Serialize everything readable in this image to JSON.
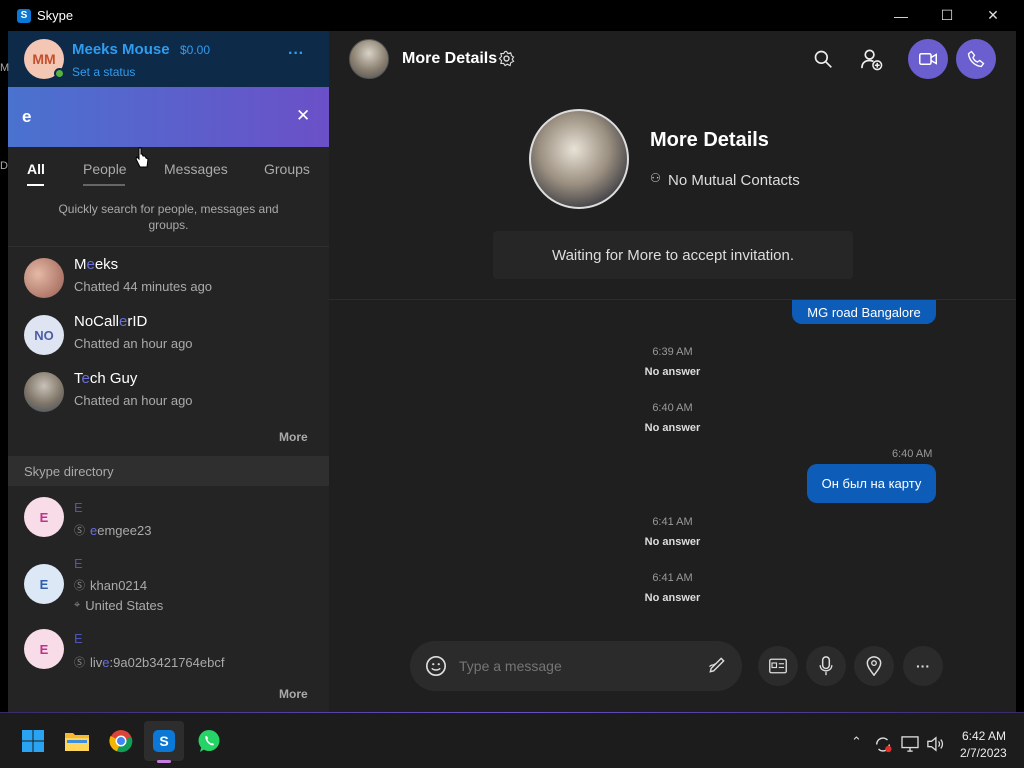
{
  "window": {
    "title": "Skype",
    "minimize": "—",
    "maximize": "☐",
    "close": "✕"
  },
  "profile": {
    "initials": "MM",
    "name": "Meeks Mouse",
    "balance": "$0.00",
    "status": "Set a status",
    "more": "···"
  },
  "search": {
    "value": "e",
    "clear": "✕"
  },
  "tabs": [
    {
      "label": "All"
    },
    {
      "label": "People"
    },
    {
      "label": "Messages"
    },
    {
      "label": "Groups"
    }
  ],
  "hint": "Quickly search for people, messages and groups.",
  "results": [
    {
      "pre": "M",
      "hl": "e",
      "post": "eks",
      "sub": "Chatted 44 minutes ago"
    },
    {
      "initials": "NO",
      "pre": "NoCall",
      "hl": "e",
      "post": "rID",
      "sub": "Chatted an hour ago"
    },
    {
      "pre": "T",
      "hl": "e",
      "post": "ch Guy",
      "sub": "Chatted an hour ago"
    }
  ],
  "results_more": "More",
  "directory": {
    "header": "Skype directory",
    "items": [
      {
        "initial": "E",
        "name": "E",
        "id_hl": "e",
        "id_rest": "emgee23"
      },
      {
        "initial": "E",
        "name": "E",
        "id_pre": "khan0214",
        "location": "United States"
      },
      {
        "initial": "E",
        "name": "E",
        "id_pre": "liv",
        "id_hl": "e",
        "id_rest": ":9a02b3421764ebcf"
      }
    ],
    "more": "More"
  },
  "chat": {
    "header_name": "More Details",
    "contact_name": "More Details",
    "mutual": "No Mutual Contacts",
    "invite": "Waiting for More to accept invitation.",
    "messages": [
      {
        "type": "bubble",
        "text": "MG road Bangalore"
      },
      {
        "type": "call",
        "time": "6:39 AM",
        "status": "No answer"
      },
      {
        "type": "call",
        "time": "6:40 AM",
        "status": "No answer"
      },
      {
        "type": "bubble",
        "time": "6:40 AM",
        "text": "Он был на карту"
      },
      {
        "type": "call",
        "time": "6:41 AM",
        "status": "No answer"
      },
      {
        "type": "call",
        "time": "6:41 AM",
        "status": "No answer"
      }
    ],
    "compose_placeholder": "Type a message"
  },
  "taskbar": {
    "time": "6:42 AM",
    "date": "2/7/2023"
  },
  "colors": {
    "accent": "#6b5fd0",
    "bubble": "#0d5db8",
    "brand": "#0a78d4",
    "highlight": "#6a6fd8"
  }
}
